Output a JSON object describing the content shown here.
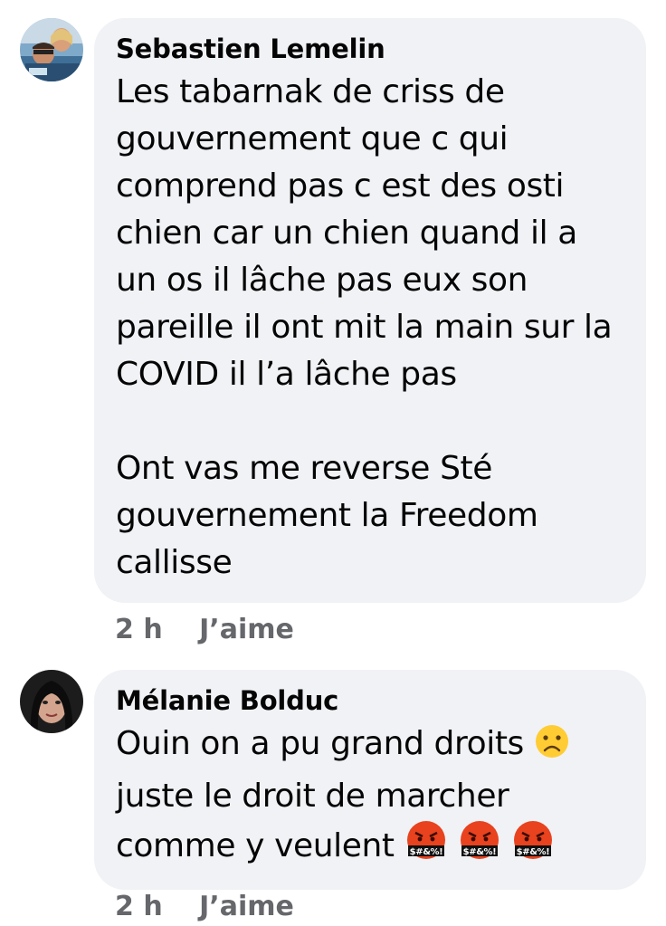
{
  "comments": [
    {
      "author": "Sebastien Lemelin",
      "paragraphs": [
        "Les tabarnak de criss de gouvernement que c qui comprend pas c est des osti chien car un chien quand il a un os il lâche pas eux son pareille il ont mit la main sur la COVID il l’a lâche pas",
        "Ont vas me reverse Sté gouvernement la Freedom callisse"
      ],
      "time": "2 h",
      "like_label": "J’aime"
    },
    {
      "author": "Mélanie Bolduc",
      "line1": "Ouin on a pu grand droits",
      "line2": "juste le droit de marcher comme y veulent",
      "time": "2 h",
      "like_label": "J’aime"
    }
  ],
  "emoji_names": [
    "frowning-face-emoji",
    "face-with-symbols-on-mouth-emoji"
  ]
}
